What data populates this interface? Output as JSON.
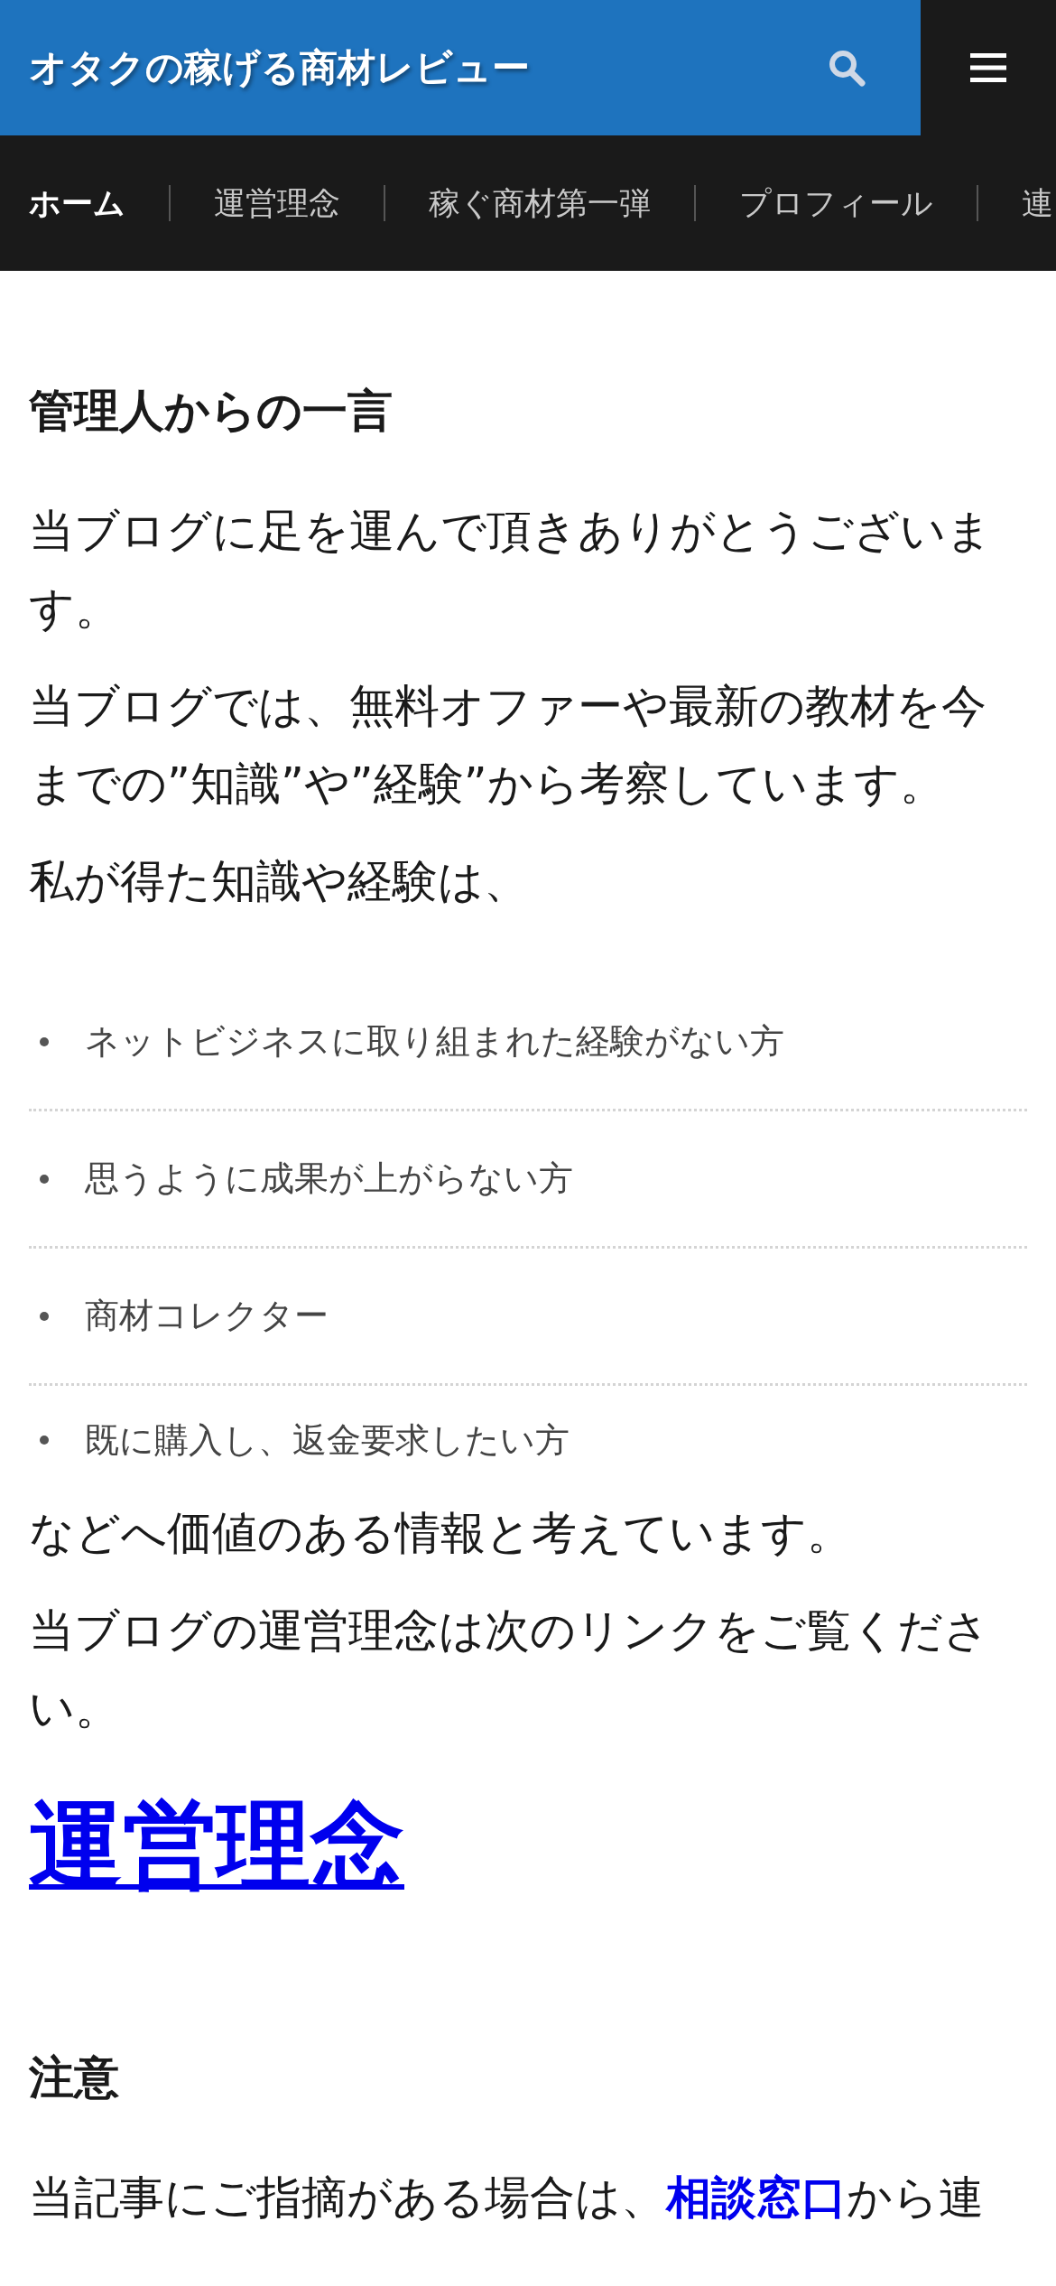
{
  "site_title": "オタクの稼げる商材レビュー",
  "nav": [
    {
      "label": "ホーム",
      "selected": true
    },
    {
      "label": "運営理念",
      "selected": false
    },
    {
      "label": "稼ぐ商材第一弾",
      "selected": false
    },
    {
      "label": "プロフィール",
      "selected": false
    },
    {
      "label": "連",
      "selected": false
    }
  ],
  "content": [
    {
      "kind": "heading",
      "text": "管理人からの一言"
    },
    {
      "kind": "paragraph",
      "parts": [
        {
          "text": "当ブログに足を運んで頂きありがとうございます。",
          "link": false
        }
      ]
    },
    {
      "kind": "paragraph",
      "parts": [
        {
          "text": "当ブログでは、無料オファーや最新の教材を今までの”知識”や”経験”から考察しています。",
          "link": false
        }
      ]
    },
    {
      "kind": "paragraph",
      "parts": [
        {
          "text": "私が得た知識や経験は、",
          "link": false
        }
      ]
    },
    {
      "kind": "list",
      "items": [
        "ネットビジネスに取り組まれた経験がない方",
        "思うように成果が上がらない方",
        "商材コレクター",
        "既に購入し、返金要求したい方"
      ]
    },
    {
      "kind": "paragraph",
      "parts": [
        {
          "text": "などへ価値のある情報と考えています。",
          "link": false
        }
      ]
    },
    {
      "kind": "paragraph",
      "parts": [
        {
          "text": "当ブログの運営理念は次のリンクをご覧ください。",
          "link": false
        }
      ]
    },
    {
      "kind": "big_link",
      "text": "運営理念"
    },
    {
      "kind": "heading",
      "text": "注意"
    },
    {
      "kind": "paragraph",
      "parts": [
        {
          "text": "当記事にご指摘がある場合は、",
          "link": false
        },
        {
          "text": "相談窓口",
          "link": true
        },
        {
          "text": "から連",
          "link": false
        }
      ]
    }
  ]
}
